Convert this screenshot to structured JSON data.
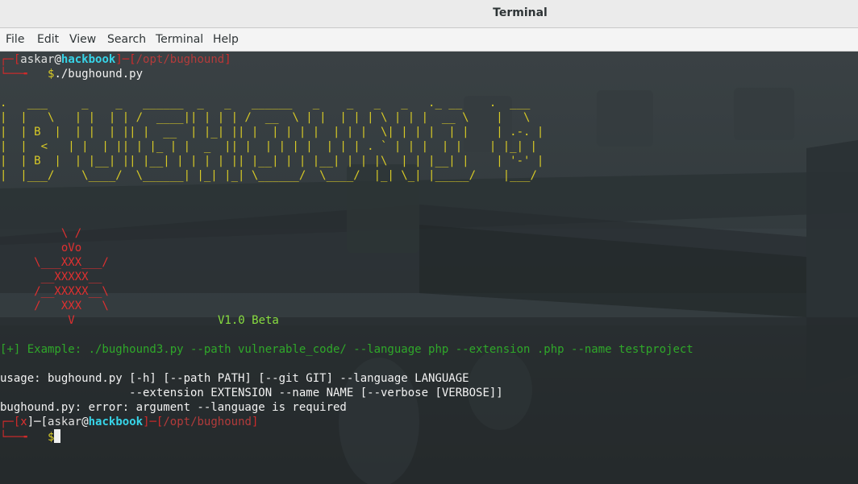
{
  "window": {
    "title": "Terminal"
  },
  "menu": [
    "File",
    "Edit",
    "View",
    "Search",
    "Terminal",
    "Help"
  ],
  "prompt1": {
    "top": "┌─[",
    "user": "askar",
    "at": "@",
    "host": "hackbook",
    "mid": "]─[",
    "path": "/opt/bughound",
    "end": "]",
    "corner": "└──╼ ",
    "dollar": "$",
    "command": "./bughound.py"
  },
  "banner": [
    ".   ___     _    _   ______  _   _   ______   _    _   _   _   ._ __    .  ___  ",
    "|  |   \\   | |  | | /  ____|| | | | /  __  \\ | |  | | | \\ | | |  __ \\    |   \\ ",
    "|  | B  |  | |  | || |  __  | |_| || |  | | | |  | | |  \\| | | |  | |    | .-. |",
    "|  |  <   | |  | || | |_ | |  _  || |  | | | |  | | | . ` | | |  | |    | |_| |",
    "|  | B  |  | |__| || |__| | | | | || |__| | | |__| | | |\\  | | |__| |    | '-' |",
    "|  |___/    \\____/  \\______| |_| |_| \\______/  \\____/  |_| \\_| |_____/    |___/ "
  ],
  "owl": [
    "         \\ /",
    "         oVo",
    "     \\___XXX___/",
    "      __XXXXX__",
    "     /__XXXXX__\\",
    "     /   XXX   \\",
    "          V"
  ],
  "version": "V1.0 Beta",
  "example": "[+] Example: ./bughound3.py --path vulnerable_code/ --language php --extension .php --name testproject",
  "usage": [
    "usage: bughound.py [-h] [--path PATH] [--git GIT] --language LANGUAGE",
    "                   --extension EXTENSION --name NAME [--verbose [VERBOSE]]",
    "bughound.py: error: argument --language is required"
  ],
  "prompt2": {
    "top": "┌─[",
    "x": "x",
    "sep": "]─[",
    "user": "askar",
    "at": "@",
    "host": "hackbook",
    "mid": "]─[",
    "path": "/opt/bughound",
    "end": "]",
    "corner": "└──╼ ",
    "dollar": "$"
  },
  "colors": {
    "title_bar": "#ebebeb",
    "menu_bar": "#f4f4f4",
    "terminal_bg": "#30363a",
    "prompt_red": "#d02a2a",
    "host_cyan": "#37d4e8",
    "banner_yellow": "#d8ca26",
    "owl_red": "#e03030",
    "version_lime": "#88dd40",
    "example_green": "#2fa82a"
  }
}
